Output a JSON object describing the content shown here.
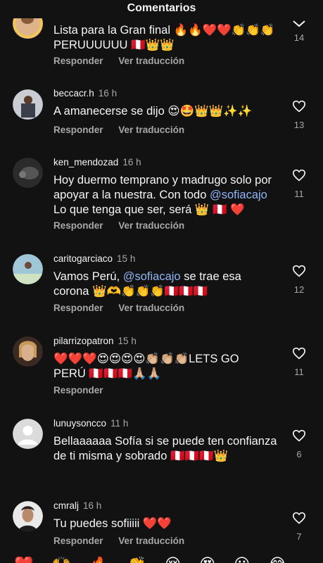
{
  "header": {
    "title": "Comentarios"
  },
  "colors": {
    "background": "#121212",
    "text": "#f5f5f5",
    "muted": "#a8a8a8",
    "mention": "#90b4f5"
  },
  "actions": {
    "reply": "Responder",
    "translate": "Ver traducción"
  },
  "comments": [
    {
      "username": "",
      "time": "",
      "lines": [
        "Lista para la Gran final 🔥🔥❤️❤️👏👏👏",
        "PERUUUUUU 🇵🇪👑👑"
      ],
      "likes": "14",
      "has_translate": true
    },
    {
      "username": "beccacr.h",
      "time": "16 h",
      "lines": [
        "A amanecerse se dijo 😍🤩👑👑✨✨"
      ],
      "likes": "13",
      "has_translate": true
    },
    {
      "username": "ken_mendozad",
      "time": "16 h",
      "lines": [
        "Hoy duermo temprano y madrugo solo por",
        "apoyar a la nuestra. Con todo ",
        "Lo que tenga que ser, será 👑 🇵🇪 ❤️"
      ],
      "mention": "@sofiacajo",
      "likes": "11",
      "has_translate": true
    },
    {
      "username": "caritogarciaco",
      "time": "15 h",
      "lines": [
        "Vamos Perú, ",
        " se trae esa",
        "corona 👑🫶👏👏👏🇵🇪🇵🇪🇵🇪"
      ],
      "mention": "@sofiacajo",
      "likes": "12",
      "has_translate": true
    },
    {
      "username": "pilarrizopatron",
      "time": "15 h",
      "lines": [
        "❤️❤️❤️😍😍😍😍👏🏼👏🏼👏🏼LETS GO",
        "PERÚ 🇵🇪🇵🇪🇵🇪🙏🏼🙏🏼"
      ],
      "likes": "11",
      "has_translate": false
    },
    {
      "username": "lunuysoncco",
      "time": "11 h",
      "lines": [
        "Bellaaaaaa Sofía si se puede ten confianza",
        "de ti misma y sobrado 🇵🇪🇵🇪🇵🇪👑"
      ],
      "likes": "6",
      "has_translate": false
    },
    {
      "username": "cmralj",
      "time": "16 h",
      "lines": [
        "Tu puedes sofiiiii ❤️❤️"
      ],
      "likes": "7",
      "has_translate": true
    }
  ],
  "emoji_bar": [
    "❤️",
    "🙌",
    "🔥",
    "👏",
    "😢",
    "😍",
    "😮",
    "😂"
  ]
}
